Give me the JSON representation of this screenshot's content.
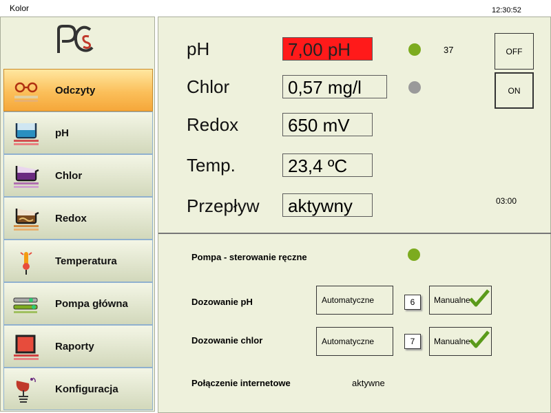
{
  "window": {
    "title": "Kolor",
    "clock": "12:30:52"
  },
  "sidebar": {
    "items": [
      {
        "label": "Odczyty",
        "icon": "glasses-icon",
        "active": true
      },
      {
        "label": "pH",
        "icon": "ph-tank-icon"
      },
      {
        "label": "Chlor",
        "icon": "chlorine-tank-icon"
      },
      {
        "label": "Redox",
        "icon": "redox-tank-icon"
      },
      {
        "label": "Temperatura",
        "icon": "thermometer-icon"
      },
      {
        "label": "Pompa główna",
        "icon": "pump-icon"
      },
      {
        "label": "Raporty",
        "icon": "report-icon"
      },
      {
        "label": "Konfiguracja",
        "icon": "satellite-dish-icon"
      }
    ]
  },
  "readings": {
    "ph": {
      "label": "pH",
      "value": "7,00 pH",
      "alarm": true
    },
    "chlor": {
      "label": "Chlor",
      "value": "0,57 mg/l"
    },
    "redox": {
      "label": "Redox",
      "value": "650 mV"
    },
    "temp": {
      "label": "Temp.",
      "value": "23,4 ºC"
    },
    "flow": {
      "label": "Przepływ",
      "value": "aktywny"
    },
    "counter": "37",
    "timer": "03:00"
  },
  "buttons": {
    "off": "OFF",
    "on": "ON"
  },
  "colors": {
    "alarm": "#ff1a1a",
    "ok": "#7cab1f",
    "inactive": "#9a9a9a",
    "accent": "#f5a73a"
  },
  "controls": {
    "pump": {
      "label": "Pompa - sterowanie ręczne"
    },
    "dosing_ph": {
      "label": "Dozowanie pH",
      "auto": "Automatyczne",
      "number": "6",
      "manual": "Manualne"
    },
    "dosing_chlor": {
      "label": "Dozowanie chlor",
      "auto": "Automatyczne",
      "number": "7",
      "manual": "Manualne"
    },
    "internet": {
      "label": "Połączenie internetowe",
      "status": "aktywne"
    }
  }
}
